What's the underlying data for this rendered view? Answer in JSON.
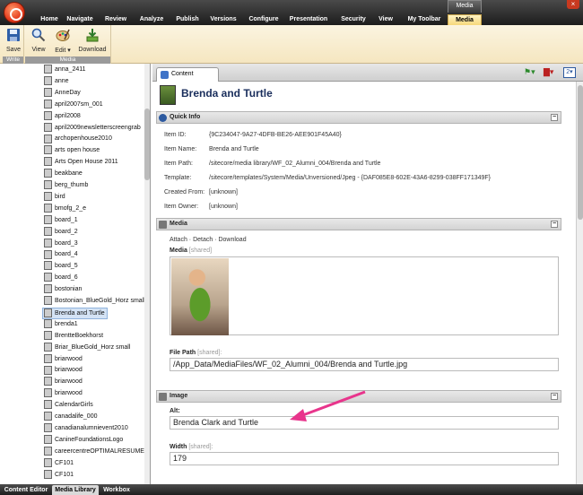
{
  "ribbon_tabs": [
    "Home",
    "Navigate",
    "Review",
    "Analyze",
    "Publish",
    "Versions",
    "Configure",
    "Presentation",
    "Security",
    "View",
    "My Toolbar",
    "Media"
  ],
  "media_context_label": "Media",
  "close": "×",
  "ribbon": {
    "write_group": {
      "label": "Write",
      "save": "Save"
    },
    "media_group": {
      "label": "Media",
      "view": "View",
      "edit": "Edit ▾",
      "download": "Download"
    }
  },
  "tree_items": [
    "anna_2411",
    "anne",
    "AnneDay",
    "april2007sm_001",
    "april2008",
    "april2009newsletterscreengrab",
    "archopenhouse2010",
    "arts open house",
    "Arts Open House 2011",
    "beakbane",
    "berg_thumb",
    "bird",
    "bmofg_2_e",
    "board_1",
    "board_2",
    "board_3",
    "board_4",
    "board_5",
    "board_6",
    "bostonian",
    "Bostonian_BlueGold_Horz small",
    "Brenda and Turtle",
    "brenda1",
    "BrentteBoekhorst",
    "Briar_BlueGold_Horz small",
    "briarwood",
    "briarwood",
    "briarwood",
    "briarwood",
    "CalendarGirls",
    "canadalife_000",
    "canadianalumnievent2010",
    "CanineFoundationsLogo",
    "careercentreOPTIMALRESUME",
    "CF101",
    "CF101"
  ],
  "content_tab": "Content",
  "item_title": "Brenda and Turtle",
  "quick_info": {
    "heading": "Quick Info",
    "rows": [
      {
        "label": "Item ID:",
        "value": "{9C234047-9A27-4DFB-BE26-AEE901F45A40}"
      },
      {
        "label": "Item Name:",
        "value": "Brenda and Turtle"
      },
      {
        "label": "Item Path:",
        "value": "/sitecore/media library/WF_02_Alumni_004/Brenda and Turtle"
      },
      {
        "label": "Template:",
        "value": "/sitecore/templates/System/Media/Unversioned/Jpeg - {DAF085E8-602E-43A6-8299-038FF171349F}"
      },
      {
        "label": "Created From:",
        "value": "[unknown]"
      },
      {
        "label": "Item Owner:",
        "value": "[unknown]"
      }
    ]
  },
  "media_section": {
    "heading": "Media",
    "actions": "Attach · Detach · Download",
    "field_label": "Media",
    "shared": "[shared]"
  },
  "file_path": {
    "label": "File Path",
    "shared": "[shared]:",
    "value": "/App_Data/MediaFiles/WF_02_Alumni_004/Brenda and Turtle.jpg"
  },
  "image_section": {
    "heading": "Image"
  },
  "alt": {
    "label": "Alt:",
    "value": "Brenda Clark and Turtle"
  },
  "width": {
    "label": "Width",
    "shared": "[shared]:",
    "value": "179"
  },
  "bottom_tabs": [
    "Content Editor",
    "Media Library",
    "Workbox"
  ],
  "colors": {
    "accent": "#f6d77a",
    "arrow": "#e8358c"
  }
}
